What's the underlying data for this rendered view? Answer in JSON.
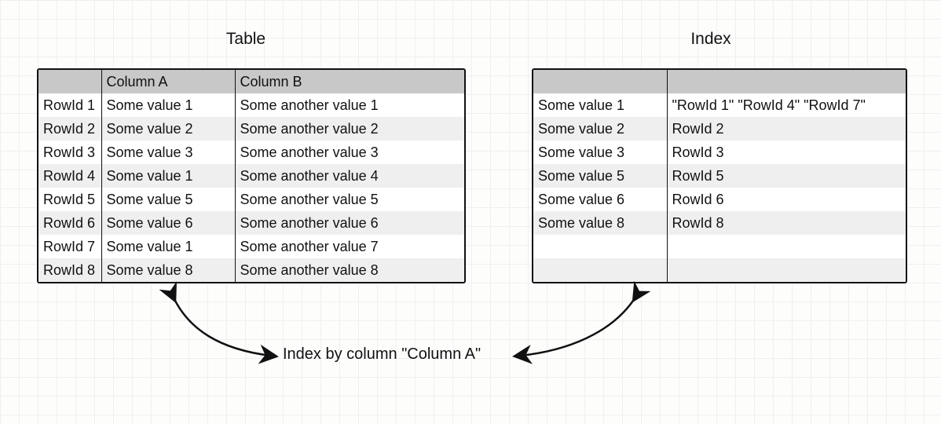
{
  "titles": {
    "left": "Table",
    "right": "Index"
  },
  "caption": "Index by column \"Column A\"",
  "table": {
    "headers": [
      "",
      "Column A",
      "Column B"
    ],
    "rows": [
      {
        "rowid": "RowId 1",
        "colA": "Some value 1",
        "colB": "Some another value 1"
      },
      {
        "rowid": "RowId 2",
        "colA": "Some value 2",
        "colB": "Some another value 2"
      },
      {
        "rowid": "RowId 3",
        "colA": "Some value 3",
        "colB": "Some another value 3"
      },
      {
        "rowid": "RowId 4",
        "colA": "Some value 1",
        "colB": "Some another value 4"
      },
      {
        "rowid": "RowId 5",
        "colA": "Some value 5",
        "colB": "Some another value 5"
      },
      {
        "rowid": "RowId 6",
        "colA": "Some value 6",
        "colB": "Some another value 6"
      },
      {
        "rowid": "RowId 7",
        "colA": "Some value 1",
        "colB": "Some another value 7"
      },
      {
        "rowid": "RowId 8",
        "colA": "Some value 8",
        "colB": "Some another value 8"
      }
    ]
  },
  "index": {
    "rows": [
      {
        "key": "Some value 1",
        "value": "\"RowId 1\" \"RowId 4\" \"RowId 7\""
      },
      {
        "key": "Some value 2",
        "value": "RowId 2"
      },
      {
        "key": "Some value 3",
        "value": "RowId 3"
      },
      {
        "key": "Some value 5",
        "value": "RowId 5"
      },
      {
        "key": "Some value 6",
        "value": "RowId 6"
      },
      {
        "key": "Some value 8",
        "value": "RowId 8"
      }
    ],
    "empty_rows": 2
  }
}
